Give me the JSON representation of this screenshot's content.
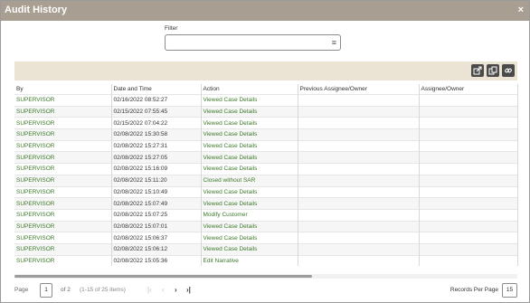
{
  "dialog": {
    "title": "Audit History",
    "close_glyph": "×"
  },
  "filter": {
    "label": "Filter",
    "value": "",
    "icon": "menu-icon"
  },
  "toolbar": {
    "icons": [
      "export-icon",
      "copy-icon",
      "link-icon"
    ]
  },
  "table": {
    "columns": [
      "By",
      "Date and Time",
      "Action",
      "Previous Assignee/Owner",
      "Assignee/Owner"
    ],
    "rows": [
      [
        "SUPERVISOR",
        "02/16/2022 08:52:27",
        "Viewed Case Details",
        "",
        ""
      ],
      [
        "SUPERVISOR",
        "02/15/2022 07:55:45",
        "Viewed Case Details",
        "",
        ""
      ],
      [
        "SUPERVISOR",
        "02/15/2022 07:04:22",
        "Viewed Case Details",
        "",
        ""
      ],
      [
        "SUPERVISOR",
        "02/08/2022 15:30:58",
        "Viewed Case Details",
        "",
        ""
      ],
      [
        "SUPERVISOR",
        "02/08/2022 15:27:31",
        "Viewed Case Details",
        "",
        ""
      ],
      [
        "SUPERVISOR",
        "02/08/2022 15:27:05",
        "Viewed Case Details",
        "",
        ""
      ],
      [
        "SUPERVISOR",
        "02/08/2022 15:16:09",
        "Viewed Case Details",
        "",
        ""
      ],
      [
        "SUPERVISOR",
        "02/08/2022 15:11:20",
        "Closed without SAR",
        "",
        ""
      ],
      [
        "SUPERVISOR",
        "02/08/2022 15:10:49",
        "Viewed Case Details",
        "",
        ""
      ],
      [
        "SUPERVISOR",
        "02/08/2022 15:07:49",
        "Viewed Case Details",
        "",
        ""
      ],
      [
        "SUPERVISOR",
        "02/08/2022 15:07:25",
        "Modify Customer",
        "",
        ""
      ],
      [
        "SUPERVISOR",
        "02/08/2022 15:07:01",
        "Viewed Case Details",
        "",
        ""
      ],
      [
        "SUPERVISOR",
        "02/08/2022 15:06:37",
        "Viewed Case Details",
        "",
        ""
      ],
      [
        "SUPERVISOR",
        "02/08/2022 15:06:12",
        "Viewed Case Details",
        "",
        ""
      ],
      [
        "SUPERVISOR",
        "02/08/2022 15:05:36",
        "Edit Narrative",
        "",
        ""
      ]
    ]
  },
  "pager": {
    "page_label": "Page",
    "page_value": "1",
    "of_text": "of 2",
    "items_text": "(1-15 of 25 items)",
    "first": "|‹",
    "prev": "‹",
    "next": "›",
    "last": "›|",
    "records_label": "Records Per Page",
    "records_value": "15"
  },
  "colors": {
    "title_bar": "#a89e91",
    "toolbar": "#ebe4d4",
    "link_green": "#3e7a2a"
  }
}
